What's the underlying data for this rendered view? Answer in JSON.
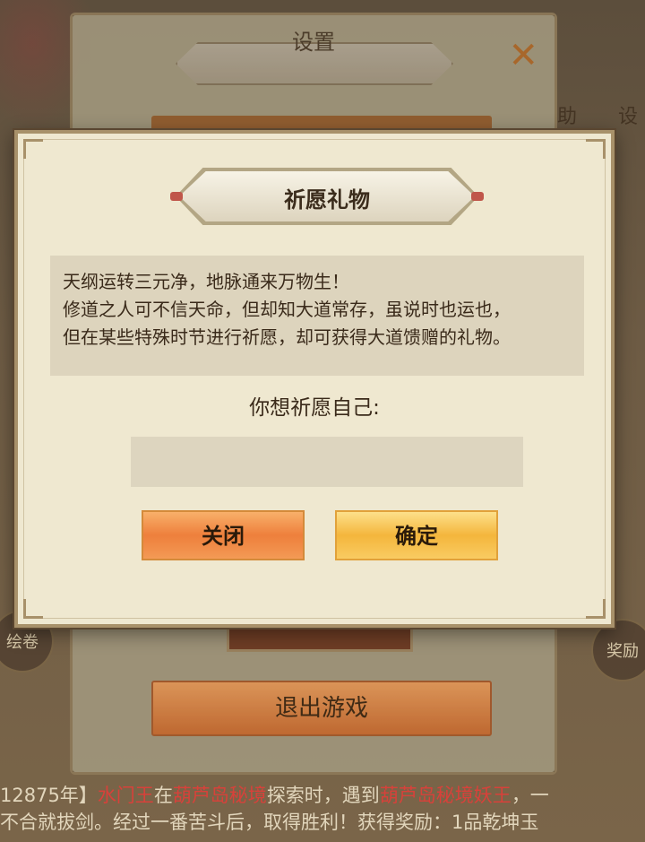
{
  "background": {
    "right_labels": [
      "助",
      "设"
    ],
    "left_icon_label": "绘卷",
    "right_icon_label": "奖励"
  },
  "settings_panel": {
    "title": "设置",
    "close_icon": "close-icon",
    "exit_label": "退出游戏"
  },
  "log": {
    "line1_prefix": "12875年】",
    "line1_name": "水门王",
    "line1_mid": "在",
    "line1_place": "葫芦岛秘境",
    "line1_mid2": "探索时，遇到",
    "line1_enemy": "葫芦岛秘境妖王",
    "line1_end": "，一",
    "line2": "不合就拔剑。经过一番苦斗后，取得胜利！获得奖励：1品乾坤玉"
  },
  "dialog": {
    "title": "祈愿礼物",
    "description": [
      "天纲运转三元净，地脉通来万物生！",
      "修道之人可不信天命，但却知大道常存，虽说时也运也，",
      "但在某些特殊时节进行祈愿，却可获得大道馈赠的礼物。"
    ],
    "prompt": "你想祈愿自己:",
    "input_value": "",
    "close_button": "关闭",
    "confirm_button": "确定"
  },
  "colors": {
    "dialog_bg": "#efe8d0",
    "close_button": "#ee7f3c",
    "confirm_button": "#f4b63c",
    "log_highlight": "#d8413a"
  }
}
